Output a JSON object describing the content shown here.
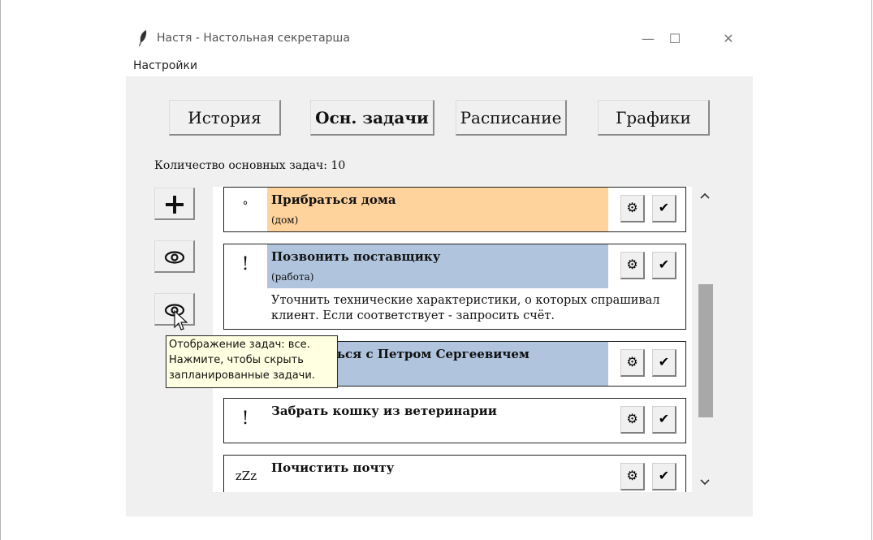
{
  "window": {
    "title": "Настя - Настольная секретарша",
    "controls": {
      "minimize": "—",
      "maximize": "☐",
      "close": "✕"
    }
  },
  "menu": {
    "settings": "Настройки"
  },
  "tabs": [
    {
      "label": "История",
      "active": false
    },
    {
      "label": "Осн. задачи",
      "active": true
    },
    {
      "label": "Расписание",
      "active": false
    },
    {
      "label": "Графики",
      "active": false
    }
  ],
  "task_count": "Количество основных задач: 10",
  "sidebar": {
    "add": "add-icon",
    "view": "eye-icon",
    "view_filter": "eye-icon"
  },
  "tasks": [
    {
      "icon": "°",
      "name": "Прибраться дома",
      "category": "(дом)",
      "color": "#ffd39b"
    },
    {
      "icon": "!",
      "name": "Позвонить поставщику",
      "category": "(работа)",
      "color": "#b0c4de",
      "description": "Уточнить технические характеристики, о которых спрашивал клиент. Если соответствует - запросить счёт."
    },
    {
      "icon": "",
      "name": "Встретиться с Петром Сергеевичем",
      "category": "",
      "color": "#b0c4de"
    },
    {
      "icon": "!",
      "name": "Забрать кошку из ветеринарии",
      "category": "",
      "color": "#ffffff"
    },
    {
      "icon": "zZz",
      "name": "Почистить почту",
      "category": "",
      "color": "#ffffff"
    }
  ],
  "tooltip": [
    "Отображение задач: все.",
    "Нажмите, чтобы скрыть",
    "запланированные задачи."
  ],
  "colors": {
    "home": "#ffd39b",
    "work": "#b0c4de",
    "window_bg": "#f0f0f0"
  }
}
